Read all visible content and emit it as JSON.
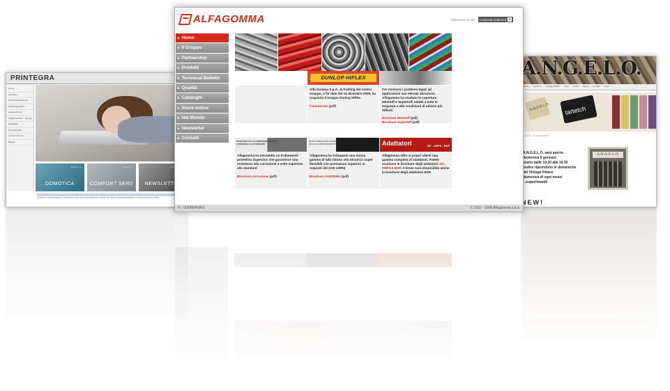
{
  "left_site": {
    "brand": "PRINTEGRA",
    "nav_items": [
      "Home",
      "Chi Siamo",
      "Servizi Progettazione",
      "Servizi Applicativi",
      "Lavora con noi",
      "Organizzazione - Stampa",
      "Newsletter",
      "Domotica Soft",
      "Comfort Service",
      "Mappa"
    ],
    "tiles": [
      {
        "sub": "Scopri la",
        "label": "DOMOTICA"
      },
      {
        "sub": "Scopri il",
        "label": "COMFORT SERV"
      },
      {
        "sub": "Iscriviti alla",
        "label": "NEWSLETTER"
      }
    ],
    "footer_text": "Printegra è un'azienda giovane e dinamica che offre servizi di progettazione e sviluppo per soluzioni integrate di domotica e comfort per la casa e l'ufficio."
  },
  "right_site": {
    "brand": "A.N.G.E.L.O.",
    "nav_items": [
      "Home",
      "Le Storie",
      "Vintage Palace",
      "Shop",
      "Eventi",
      "Press",
      "Contatti",
      "Links"
    ],
    "banner_tag": "tartetch",
    "tag_label": "A.N.G.E.L.O.",
    "date_line": "Lugo 9/1 • 11 gennaio 2008",
    "text_lines": [
      "A.N.G.E.L.O. sarà aperta",
      "domenica 6 gennaio",
      "orario dalle 10.30 alle 19.30",
      "",
      "Inoltre riprendono le domeniche",
      "del Vintage Palace",
      "domenica di ogni mese!",
      "",
      "...supertimanti!"
    ],
    "shop_sign": "A.N.G.E.L.O.",
    "news_heading": "NEW!",
    "stripe_colors": [
      "#8a2f2f",
      "#d6c25a",
      "#6f9b6f",
      "#c88a9b",
      "#6b4f82"
    ]
  },
  "main_site": {
    "brand": "ALFAGOMMA",
    "lang_label": "Seleziona un sito:",
    "lang_value": "Corporate [Italiano]",
    "nav": [
      "Home",
      "Il Gruppo",
      "Partnership",
      "Prodotti",
      "Technical Bulletin",
      "Qualità",
      "Cataloghi",
      "Stock online",
      "Nel Mondo",
      "Newsletter",
      "Contatti"
    ],
    "dunlop_label": "DUNLOP HIFLEX",
    "cells_top": [
      {
        "text": "",
        "link": ""
      },
      {
        "text": "Alfa Gomma S.p.A., la holding del nostro Gruppo, a far data dal 14 dicembre 2005, ha acquisito il Gruppo Dunlop Hiflex.",
        "link": "Comunicato",
        "pdf": "(pdf)"
      },
      {
        "text": "Per risolvere i problemi legati ad applicazioni con elevata abrasione, Alfagomma ha studiato le coperture Minetuff e Supertuff, adatte a tutte le esigenze e alle condizioni di utilizzo più difficili.",
        "link": "Brochure Minetuff",
        "link2": "Brochure Supertuff",
        "pdf": "(pdf)"
      }
    ],
    "strip1_text": "RESISTENZA ALLA CORROSIONE 4 VOLTE SUPERIORE ALLO STANDARD",
    "strip2_text": "NUOVA GAMMA EXTRA FLESSIBILE CON RAGGI DI CURVATURA RIDOTTI",
    "adattatori_label": "Adattatori",
    "adattatori_sub": "JIC - ORFS - BSP",
    "cells_bottom": [
      {
        "text": "Alfagomma ha introdotto un trattamento protettivo Superzinc che garantisce una resistenza alla corrosione 4 volte superiore allo standard",
        "link": "Brochure corrosione",
        "pdf": "(pdf)"
      },
      {
        "text": "Alfagomma ha sviluppato una nuova gamma di tubi ritorno olio idraulico super flessibili con prestazioni superiori ai requisiti del SAE 100R4",
        "link": "Brochure SAE100R4",
        "pdf": "(pdf)"
      },
      {
        "text_a": "Alfagomma offre ai propri clienti una gamma completa di adattatori. Potete scaricare le brochure degli adattatori ",
        "link_a": "JIC, ORFS",
        "text_b": " e ",
        "link_b": "BSP",
        "text_c": ". A breve sarà disponibile anche la brochure degli adattatori BSP."
      }
    ],
    "footer_left": "P.I. 00689040962",
    "footer_right": "© 2002 - 2008 Alfagomma s.p.a."
  }
}
